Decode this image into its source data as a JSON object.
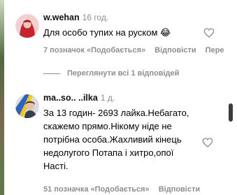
{
  "comments": [
    {
      "username": "w.wehan",
      "time": "16 год.",
      "text": "Для особо тупих на руском 😂",
      "likes": "7 позначок «Подобається»",
      "reply": "Відповісти",
      "more": "Пере"
    },
    {
      "username": "ma..so.. ..ilka",
      "time": "1 д.",
      "text": "За 13 годин- 2693 лайка.Небагато, скажемо прямо.Нікому ніде не потрібна особа.Жахливий кінець недолугого Потапа і хитро,опої Насті.",
      "likes": "51 позначка «Подобається»",
      "reply": "Відповісти"
    }
  ],
  "view_replies": "Переглянути всі 1 відповідей",
  "colors": {
    "muted": "#8e8e8e",
    "text": "#000000"
  }
}
